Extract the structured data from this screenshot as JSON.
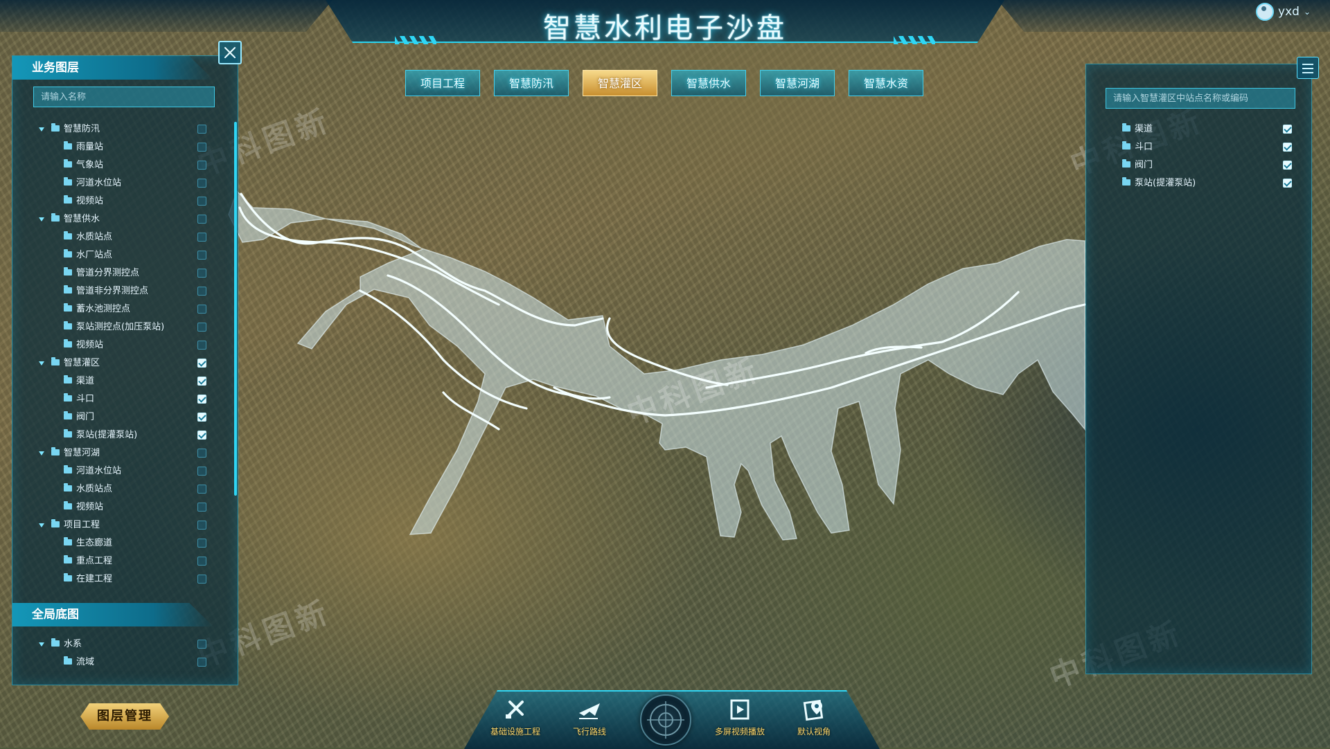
{
  "header": {
    "title": "智慧水利电子沙盘",
    "user": "yxd"
  },
  "watermark": "中科图新",
  "tabs": [
    {
      "label": "项目工程",
      "active": false
    },
    {
      "label": "智慧防汛",
      "active": false
    },
    {
      "label": "智慧灌区",
      "active": true
    },
    {
      "label": "智慧供水",
      "active": false
    },
    {
      "label": "智慧河湖",
      "active": false
    },
    {
      "label": "智慧水资",
      "active": false
    }
  ],
  "business_layers": {
    "title": "业务图层",
    "search_placeholder": "请输入名称",
    "groups": [
      {
        "label": "智慧防汛",
        "checked": false,
        "items": [
          {
            "label": "雨量站",
            "checked": false
          },
          {
            "label": "气象站",
            "checked": false
          },
          {
            "label": "河道水位站",
            "checked": false
          },
          {
            "label": "视频站",
            "checked": false
          }
        ]
      },
      {
        "label": "智慧供水",
        "checked": false,
        "items": [
          {
            "label": "水质站点",
            "checked": false
          },
          {
            "label": "水厂站点",
            "checked": false
          },
          {
            "label": "管道分界测控点",
            "checked": false
          },
          {
            "label": "管道非分界测控点",
            "checked": false
          },
          {
            "label": "蓄水池测控点",
            "checked": false
          },
          {
            "label": "泵站测控点(加压泵站)",
            "checked": false
          },
          {
            "label": "视频站",
            "checked": false
          }
        ]
      },
      {
        "label": "智慧灌区",
        "checked": true,
        "items": [
          {
            "label": "渠道",
            "checked": true
          },
          {
            "label": "斗口",
            "checked": true
          },
          {
            "label": "阀门",
            "checked": true
          },
          {
            "label": "泵站(提灌泵站)",
            "checked": true
          }
        ]
      },
      {
        "label": "智慧河湖",
        "checked": false,
        "items": [
          {
            "label": "河道水位站",
            "checked": false
          },
          {
            "label": "水质站点",
            "checked": false
          },
          {
            "label": "视频站",
            "checked": false
          }
        ]
      },
      {
        "label": "项目工程",
        "checked": false,
        "items": [
          {
            "label": "生态廊道",
            "checked": false
          },
          {
            "label": "重点工程",
            "checked": false
          },
          {
            "label": "在建工程",
            "checked": false
          }
        ]
      }
    ]
  },
  "base_map": {
    "title": "全局底图",
    "groups": [
      {
        "label": "水系",
        "checked": false,
        "items": [
          {
            "label": "流域",
            "checked": false
          }
        ]
      }
    ]
  },
  "layer_manage_label": "图层管理",
  "right_panel": {
    "search_placeholder": "请输入智慧灌区中站点名称或编码",
    "items": [
      {
        "label": "渠道",
        "checked": true
      },
      {
        "label": "斗口",
        "checked": true
      },
      {
        "label": "阀门",
        "checked": true
      },
      {
        "label": "泵站(提灌泵站)",
        "checked": true
      }
    ]
  },
  "dock": [
    {
      "label": "基础设施工程",
      "icon": "tools-icon"
    },
    {
      "label": "飞行路线",
      "icon": "plane-icon"
    },
    {
      "label": "多屏视频播放",
      "icon": "video-icon"
    },
    {
      "label": "默认视角",
      "icon": "map-pin-icon"
    }
  ],
  "colors": {
    "accent": "#2fd6f5",
    "active_tab": "#e8b34f",
    "panel_bg": "#082c3c"
  }
}
